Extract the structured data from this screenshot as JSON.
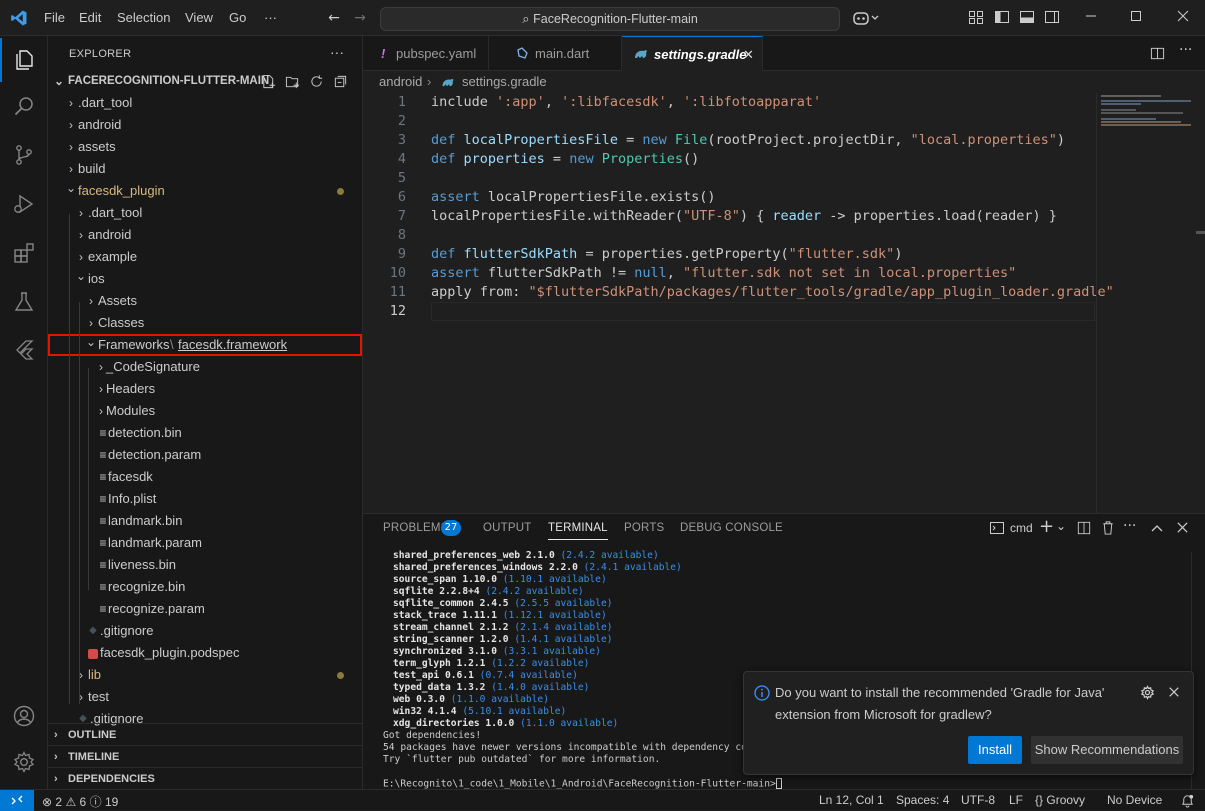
{
  "titlebar": {
    "menu": [
      "File",
      "Edit",
      "Selection",
      "View",
      "Go"
    ],
    "search_text": "FaceRecognition-Flutter-main"
  },
  "explorer": {
    "title": "EXPLORER",
    "project": "FACERECOGNITION-FLUTTER-MAIN",
    "tree": [
      {
        "label": ".dart_tool",
        "type": "folder",
        "depth": 0,
        "expanded": false
      },
      {
        "label": "android",
        "type": "folder",
        "depth": 0,
        "expanded": false
      },
      {
        "label": "assets",
        "type": "folder",
        "depth": 0,
        "expanded": false
      },
      {
        "label": "build",
        "type": "folder",
        "depth": 0,
        "expanded": false
      },
      {
        "label": "facesdk_plugin",
        "type": "folder",
        "depth": 0,
        "expanded": true,
        "modified": true
      },
      {
        "label": ".dart_tool",
        "type": "folder",
        "depth": 1,
        "expanded": false
      },
      {
        "label": "android",
        "type": "folder",
        "depth": 1,
        "expanded": false
      },
      {
        "label": "example",
        "type": "folder",
        "depth": 1,
        "expanded": false
      },
      {
        "label": "ios",
        "type": "folder",
        "depth": 1,
        "expanded": true
      },
      {
        "label": "Assets",
        "type": "folder",
        "depth": 2,
        "expanded": false
      },
      {
        "label": "Classes",
        "type": "folder",
        "depth": 2,
        "expanded": false
      },
      {
        "label": "Frameworks",
        "label2": "facesdk.framework",
        "type": "folder",
        "depth": 2,
        "expanded": true,
        "highlight": true
      },
      {
        "label": "_CodeSignature",
        "type": "folder",
        "depth": 3,
        "expanded": false
      },
      {
        "label": "Headers",
        "type": "folder",
        "depth": 3,
        "expanded": false
      },
      {
        "label": "Modules",
        "type": "folder",
        "depth": 3,
        "expanded": false
      },
      {
        "label": "detection.bin",
        "type": "file",
        "depth": 3
      },
      {
        "label": "detection.param",
        "type": "file",
        "depth": 3
      },
      {
        "label": "facesdk",
        "type": "file",
        "depth": 3
      },
      {
        "label": "Info.plist",
        "type": "file",
        "depth": 3
      },
      {
        "label": "landmark.bin",
        "type": "file",
        "depth": 3
      },
      {
        "label": "landmark.param",
        "type": "file",
        "depth": 3
      },
      {
        "label": "liveness.bin",
        "type": "file",
        "depth": 3
      },
      {
        "label": "recognize.bin",
        "type": "file",
        "depth": 3
      },
      {
        "label": "recognize.param",
        "type": "file",
        "depth": 3
      },
      {
        "label": ".gitignore",
        "type": "gitfile",
        "depth": 2
      },
      {
        "label": "facesdk_plugin.podspec",
        "type": "podfile",
        "depth": 2
      },
      {
        "label": "lib",
        "type": "folder",
        "depth": 1,
        "expanded": false,
        "modified": true,
        "yellow": true
      },
      {
        "label": "test",
        "type": "folder",
        "depth": 1,
        "expanded": false
      },
      {
        "label": ".gitignore",
        "type": "gitfile",
        "depth": 1
      }
    ],
    "sections": [
      "OUTLINE",
      "TIMELINE",
      "DEPENDENCIES"
    ]
  },
  "tabs": [
    {
      "label": "pubspec.yaml",
      "icon": "!"
    },
    {
      "label": "main.dart",
      "icon": "dart"
    },
    {
      "label": "settings.gradle",
      "icon": "gradle",
      "active": true
    }
  ],
  "breadcrumb": [
    "android",
    "settings.gradle"
  ],
  "code_lines": [
    "1",
    "2",
    "3",
    "4",
    "5",
    "6",
    "7",
    "8",
    "9",
    "10",
    "11",
    "12"
  ],
  "code_text": {
    "l1a": "include ",
    "l1b": "':app'",
    "l1c": ", ",
    "l1d": "':libfacesdk'",
    "l1e": ", ",
    "l1f": "':libfotoapparat'",
    "l3a": "def ",
    "l3b": "localPropertiesFile",
    " l3c": "",
    "l3d": "new ",
    "l3e": "File",
    "l3f": "rootProject.projectDir, ",
    "l3g": "\"local.properties\"",
    "l4a": "def ",
    "l4b": "properties",
    "l4d": "new ",
    "l4e": "Properties",
    "l6a": "assert ",
    "l6b": "localPropertiesFile.exists()",
    "l7a": "localPropertiesFile.withReader(",
    "l7b": "\"UTF-8\"",
    "l7c": ") { ",
    "l7d": "reader",
    "l7e": " -> properties.load(reader) }",
    "l9a": "def ",
    "l9b": "flutterSdkPath",
    "l9c": " = properties.getProperty(",
    "l9d": "\"flutter.sdk\"",
    "l9e": ")",
    "l10a": "assert ",
    "l10b": "flutterSdkPath != ",
    "l10c": "null",
    "l10d": ", ",
    "l10e": "\"flutter.sdk not set in local.properties\"",
    "l11a": "apply from: ",
    "l11b": "\"$flutterSdkPath",
    "l11c": "/packages/flutter_tools/gradle/app_plugin_loader.gradle\""
  },
  "panel": {
    "tabs": [
      "PROBLEMS",
      "OUTPUT",
      "TERMINAL",
      "PORTS",
      "DEBUG CONSOLE"
    ],
    "problems_count": "27",
    "shell": "cmd",
    "packages": [
      [
        "shared_preferences_web",
        "2.1.0",
        "(2.4.2 available)"
      ],
      [
        "shared_preferences_windows",
        "2.2.0",
        "(2.4.1 available)"
      ],
      [
        "source_span",
        "1.10.0",
        "(1.10.1 available)"
      ],
      [
        "sqflite",
        "2.2.8+4",
        "(2.4.2 available)"
      ],
      [
        "sqflite_common",
        "2.4.5",
        "(2.5.5 available)"
      ],
      [
        "stack_trace",
        "1.11.1",
        "(1.12.1 available)"
      ],
      [
        "stream_channel",
        "2.1.2",
        "(2.1.4 available)"
      ],
      [
        "string_scanner",
        "1.2.0",
        "(1.4.1 available)"
      ],
      [
        "synchronized",
        "3.1.0",
        "(3.3.1 available)"
      ],
      [
        "term_glyph",
        "1.2.1",
        "(1.2.2 available)"
      ],
      [
        "test_api",
        "0.6.1",
        "(0.7.4 available)"
      ],
      [
        "typed_data",
        "1.3.2",
        "(1.4.0 available)"
      ],
      [
        "web",
        "0.3.0",
        "(1.1.0 available)"
      ],
      [
        "win32",
        "4.1.4",
        "(5.10.1 available)"
      ],
      [
        "xdg_directories",
        "1.0.0",
        "(1.1.0 available)"
      ]
    ],
    "msg1": "Got dependencies!",
    "msg2": "54 packages have newer versions incompatible with dependency constraints.",
    "msg3": "Try `flutter pub outdated` for more information.",
    "prompt": "E:\\Recognito\\1_code\\1_Mobile\\1_Android\\FaceRecognition-Flutter-main>"
  },
  "notification": {
    "text": "Do you want to install the recommended 'Gradle for Java' extension from Microsoft for gradlew?",
    "install": "Install",
    "show": "Show Recommendations"
  },
  "status": {
    "errors": "2",
    "warnings": "6",
    "info": "19",
    "position": "Ln 12, Col 1",
    "spaces": "Spaces: 4",
    "encoding": "UTF-8",
    "eol": "LF",
    "language": "Groovy",
    "device": "No Device"
  },
  "colors": {
    "accent": "#0078d4",
    "highlight_box": "#e51400",
    "modified_dot": "#8a7a3c"
  }
}
